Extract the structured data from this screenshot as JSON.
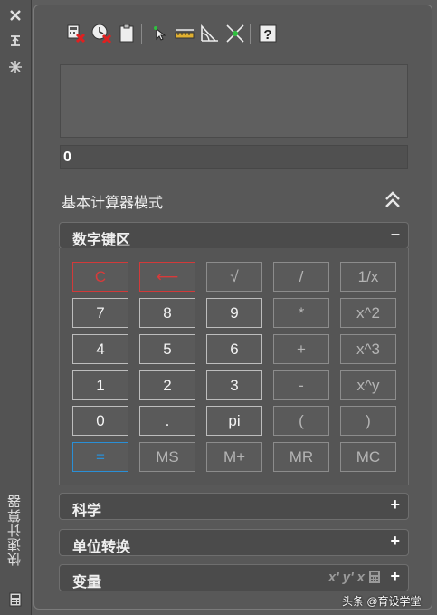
{
  "window": {
    "title": "快速计算器"
  },
  "toolbar": {
    "buttons": [
      {
        "name": "clear-button",
        "icon": "clear-icon"
      },
      {
        "name": "clear-history-button",
        "icon": "clear-history-icon"
      },
      {
        "name": "paste-value-button",
        "icon": "paste-icon"
      },
      {
        "name": "get-coordinates-button",
        "icon": "pick-point-icon"
      },
      {
        "name": "distance-between-points-button",
        "icon": "distance-icon"
      },
      {
        "name": "angle-of-line-button",
        "icon": "angle-icon"
      },
      {
        "name": "intersection-of-lines-button",
        "icon": "intersection-icon"
      },
      {
        "name": "help-button",
        "icon": "help-icon"
      }
    ]
  },
  "display": {
    "history": "",
    "input_value": "0"
  },
  "mode": {
    "label": "基本计算器模式"
  },
  "sections": {
    "numpad": {
      "title": "数字键区",
      "toggle": "–"
    },
    "science": {
      "title": "科学",
      "toggle": "+"
    },
    "units": {
      "title": "单位转换",
      "toggle": "+"
    },
    "variables": {
      "title": "变量",
      "toggle": "+",
      "icons": [
        "x'",
        "y'",
        "x",
        "calculator-icon"
      ]
    }
  },
  "keypad": {
    "rows": [
      [
        "C",
        "⟵",
        "√",
        "/",
        "1/x"
      ],
      [
        "7",
        "8",
        "9",
        "*",
        "x^2"
      ],
      [
        "4",
        "5",
        "6",
        "+",
        "x^3"
      ],
      [
        "1",
        "2",
        "3",
        "-",
        "x^y"
      ],
      [
        "0",
        ".",
        "pi",
        "(",
        ")"
      ],
      [
        "=",
        "MS",
        "M+",
        "MR",
        "MC"
      ]
    ]
  },
  "watermark": "头条 @育设学堂",
  "colors": {
    "panel": "#585858",
    "clear_key": "#d23a3a",
    "equals_key": "#2a8fd6"
  }
}
